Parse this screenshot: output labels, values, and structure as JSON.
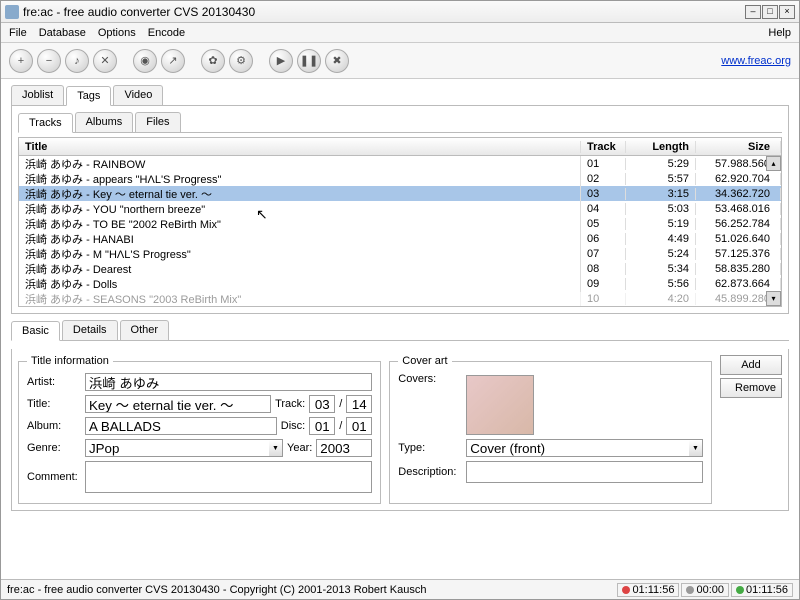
{
  "window": {
    "title": "fre:ac - free audio converter CVS 20130430"
  },
  "menu": {
    "file": "File",
    "database": "Database",
    "options": "Options",
    "encode": "Encode",
    "help": "Help"
  },
  "link": {
    "url": "www.freac.org"
  },
  "main_tabs": {
    "joblist": "Joblist",
    "tags": "Tags",
    "video": "Video"
  },
  "sub_tabs": {
    "tracks": "Tracks",
    "albums": "Albums",
    "files": "Files"
  },
  "columns": {
    "title": "Title",
    "track": "Track",
    "length": "Length",
    "size": "Size"
  },
  "tracks": [
    {
      "title": "浜崎 あゆみ - RAINBOW",
      "track": "01",
      "length": "5:29",
      "size": "57.988.560"
    },
    {
      "title": "浜崎 あゆみ - appears \"HΛL'S Progress\"",
      "track": "02",
      "length": "5:57",
      "size": "62.920.704"
    },
    {
      "title": "浜崎 あゆみ - Key ～ eternal tie ver. ～",
      "track": "03",
      "length": "3:15",
      "size": "34.362.720"
    },
    {
      "title": "浜崎 あゆみ - YOU \"northern breeze\"",
      "track": "04",
      "length": "5:03",
      "size": "53.468.016"
    },
    {
      "title": "浜崎 あゆみ - TO BE \"2002 ReBirth Mix\"",
      "track": "05",
      "length": "5:19",
      "size": "56.252.784"
    },
    {
      "title": "浜崎 あゆみ - HANABI",
      "track": "06",
      "length": "4:49",
      "size": "51.026.640"
    },
    {
      "title": "浜崎 あゆみ - M \"HΛL'S Progress\"",
      "track": "07",
      "length": "5:24",
      "size": "57.125.376"
    },
    {
      "title": "浜崎 あゆみ - Dearest",
      "track": "08",
      "length": "5:34",
      "size": "58.835.280"
    },
    {
      "title": "浜崎 あゆみ - Dolls",
      "track": "09",
      "length": "5:56",
      "size": "62.873.664"
    },
    {
      "title": "浜崎 あゆみ - SEASONS \"2003 ReBirth Mix\"",
      "track": "10",
      "length": "4:20",
      "size": "45.899.280"
    }
  ],
  "detail_tabs": {
    "basic": "Basic",
    "details": "Details",
    "other": "Other"
  },
  "title_info": {
    "legend": "Title information",
    "labels": {
      "artist": "Artist:",
      "title": "Title:",
      "album": "Album:",
      "genre": "Genre:",
      "comment": "Comment:",
      "track": "Track:",
      "disc": "Disc:",
      "year": "Year:"
    },
    "artist": "浜崎 あゆみ",
    "title": "Key ～ eternal tie ver. ～",
    "album": "A BALLADS",
    "genre": "JPop",
    "track": "03",
    "track_total": "14",
    "disc": "01",
    "disc_total": "01",
    "year": "2003"
  },
  "cover": {
    "legend": "Cover art",
    "labels": {
      "covers": "Covers:",
      "type": "Type:",
      "description": "Description:"
    },
    "type": "Cover (front)",
    "add": "Add",
    "remove": "Remove"
  },
  "status": {
    "text": "fre:ac - free audio converter CVS 20130430 - Copyright (C) 2001-2013 Robert Kausch",
    "time1": "01:11:56",
    "time2": "00:00",
    "time3": "01:11:56"
  }
}
